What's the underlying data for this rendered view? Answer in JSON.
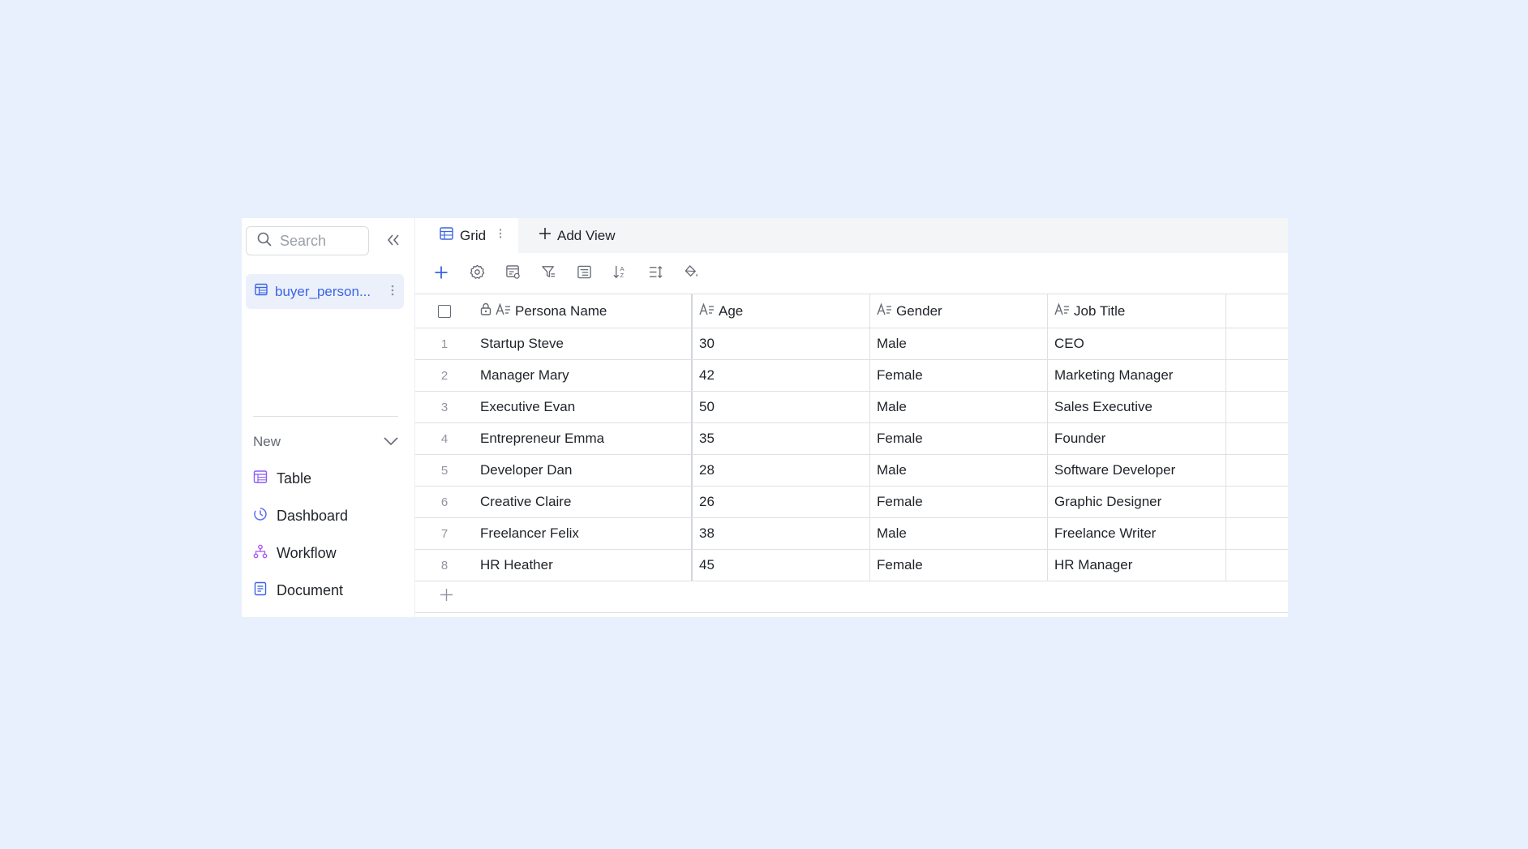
{
  "colors": {
    "background": "#e8effd",
    "accent": "#3a65e4",
    "sidebar_active_bg": "#ecf0fb",
    "tabbar_bg": "#f4f5f7"
  },
  "sidebar": {
    "search": {
      "placeholder": "Search",
      "icon": "search-icon"
    },
    "collapse_icon": "double-chevron-left-icon",
    "tables": [
      {
        "label": "buyer_person...",
        "icon": "table-icon",
        "active": true
      }
    ],
    "new_section": {
      "label": "New",
      "icon": "chevron-down-icon",
      "items": [
        {
          "label": "Table",
          "icon": "table-icon"
        },
        {
          "label": "Dashboard",
          "icon": "dashboard-icon"
        },
        {
          "label": "Workflow",
          "icon": "workflow-icon"
        },
        {
          "label": "Document",
          "icon": "document-icon"
        }
      ]
    }
  },
  "tabs": {
    "active": {
      "label": "Grid",
      "icon": "grid-icon"
    },
    "add_view": {
      "label": "Add View",
      "icon": "plus-icon"
    }
  },
  "toolbar": [
    {
      "name": "add-record",
      "icon": "plus-icon"
    },
    {
      "name": "settings",
      "icon": "gear-icon"
    },
    {
      "name": "form",
      "icon": "form-settings-icon"
    },
    {
      "name": "filter",
      "icon": "filter-icon"
    },
    {
      "name": "group",
      "icon": "group-icon"
    },
    {
      "name": "sort",
      "icon": "sort-icon"
    },
    {
      "name": "row-height",
      "icon": "row-height-icon"
    },
    {
      "name": "color",
      "icon": "paint-bucket-icon"
    }
  ],
  "grid": {
    "columns": [
      {
        "key": "name",
        "label": "Persona Name",
        "icon": "text-field-icon",
        "primary": true
      },
      {
        "key": "age",
        "label": "Age",
        "icon": "text-field-icon"
      },
      {
        "key": "gender",
        "label": "Gender",
        "icon": "text-field-icon"
      },
      {
        "key": "job",
        "label": "Job Title",
        "icon": "text-field-icon"
      }
    ],
    "rows": [
      {
        "index": "1",
        "name": "Startup Steve",
        "age": "30",
        "gender": "Male",
        "job": "CEO"
      },
      {
        "index": "2",
        "name": "Manager Mary",
        "age": "42",
        "gender": "Female",
        "job": "Marketing Manager"
      },
      {
        "index": "3",
        "name": "Executive Evan",
        "age": "50",
        "gender": "Male",
        "job": "Sales Executive"
      },
      {
        "index": "4",
        "name": "Entrepreneur Emma",
        "age": "35",
        "gender": "Female",
        "job": "Founder"
      },
      {
        "index": "5",
        "name": "Developer Dan",
        "age": "28",
        "gender": "Male",
        "job": "Software Developer"
      },
      {
        "index": "6",
        "name": "Creative Claire",
        "age": "26",
        "gender": "Female",
        "job": "Graphic Designer"
      },
      {
        "index": "7",
        "name": "Freelancer Felix",
        "age": "38",
        "gender": "Male",
        "job": "Freelance Writer"
      },
      {
        "index": "8",
        "name": "HR Heather",
        "age": "45",
        "gender": "Female",
        "job": "HR Manager"
      }
    ]
  }
}
